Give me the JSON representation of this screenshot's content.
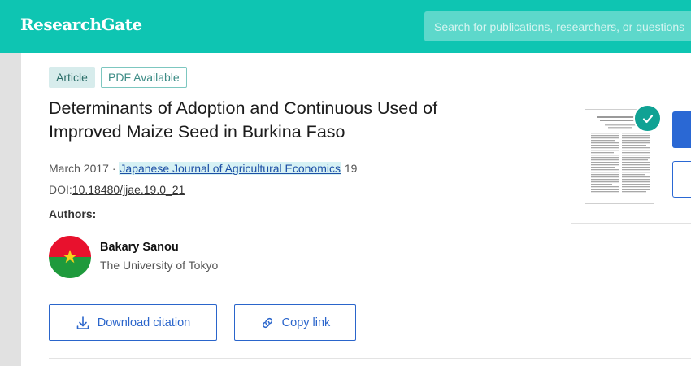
{
  "header": {
    "logo": "ResearchGate",
    "search_placeholder": "Search for publications, researchers, or questions"
  },
  "article": {
    "type_badge": "Article",
    "pdf_badge": "PDF Available",
    "title": "Determinants of Adoption and Continuous Used of Improved Maize Seed in Burkina Faso",
    "date": "March 2017",
    "separator": "·",
    "journal": "Japanese Journal of Agricultural Economics",
    "volume": "19",
    "doi_label": "DOI:",
    "doi": "10.18480/jjae.19.0_21"
  },
  "authors": {
    "label": "Authors:",
    "items": [
      {
        "name": "Bakary Sanou",
        "institution": "The University of Tokyo",
        "avatar_icon": "burkina-faso-flag-icon"
      }
    ]
  },
  "actions": {
    "download_citation": "Download citation",
    "copy_link": "Copy link"
  },
  "colors": {
    "brand": "#0ec5b2",
    "link_blue": "#2a65cb",
    "check_teal": "#10a294"
  }
}
